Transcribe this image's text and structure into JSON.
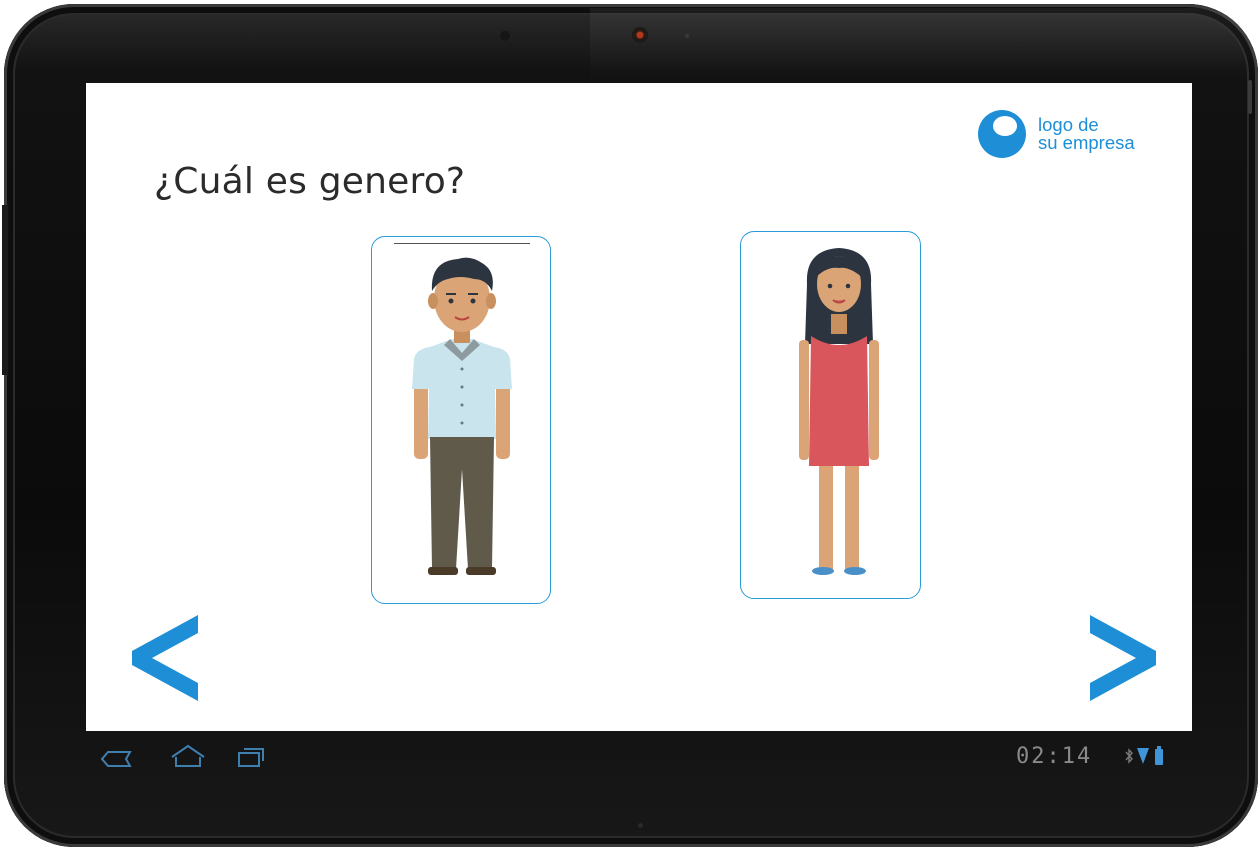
{
  "screen": {
    "question": "¿Cuál es genero?",
    "logo": {
      "line1": "logo de",
      "line2": "su empresa",
      "icon": "logo-circle-icon"
    },
    "options": [
      {
        "id": "male",
        "icon": "man-figure-icon"
      },
      {
        "id": "female",
        "icon": "woman-figure-icon"
      }
    ],
    "navigation": {
      "prev_icon": "chevron-left-icon",
      "next_icon": "chevron-right-icon"
    }
  },
  "systembar": {
    "clock": "02:14",
    "icons": [
      "back-icon",
      "home-icon",
      "recent-apps-icon",
      "bluetooth-icon",
      "wifi-icon",
      "battery-icon"
    ]
  },
  "colors": {
    "accent": "#1e8fd6",
    "card_border": "#2a9bd8",
    "text": "#2b2b2b",
    "dress": "#d9565c",
    "shirt": "#c9e4ec",
    "pants": "#605a4b",
    "skin": "#dba477",
    "hair": "#2c3440"
  }
}
